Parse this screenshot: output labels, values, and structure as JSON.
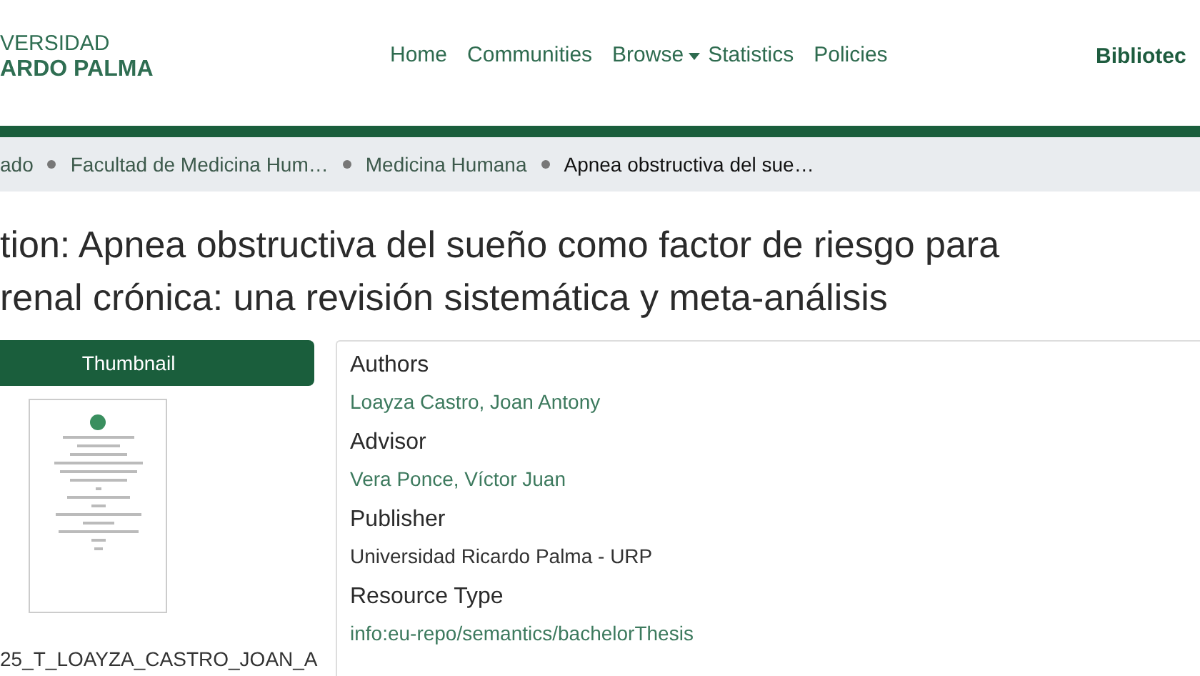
{
  "header": {
    "logo_lines": [
      "VERSIDAD",
      "ARDO PALMA"
    ],
    "nav": [
      {
        "label": "Home",
        "dropdown": false
      },
      {
        "label": "Communities",
        "dropdown": false
      },
      {
        "label": "Browse",
        "dropdown": true
      },
      {
        "label": "Statistics",
        "dropdown": false
      },
      {
        "label": "Policies",
        "dropdown": false
      }
    ],
    "site_title": "Bibliotec"
  },
  "breadcrumb": [
    {
      "label": "ado",
      "current": false
    },
    {
      "label": "Facultad de Medicina Hum…",
      "current": false
    },
    {
      "label": "Medicina Humana",
      "current": false
    },
    {
      "label": "Apnea obstructiva del sue…",
      "current": true
    }
  ],
  "title_lines": [
    "tion: Apnea obstructiva del sueño como factor de riesgo para",
    "renal crónica: una revisión sistemática y meta-análisis"
  ],
  "thumbnail": {
    "heading": "Thumbnail",
    "file_name": "25_T_LOAYZA_CASTRO_JOAN_A"
  },
  "fields": [
    {
      "label": "Authors",
      "value": "Loayza Castro, Joan Antony",
      "link": true
    },
    {
      "label": "Advisor",
      "value": "Vera Ponce, Víctor Juan",
      "link": true
    },
    {
      "label": "Publisher",
      "value": "Universidad Ricardo Palma - URP",
      "link": false
    },
    {
      "label": "Resource Type",
      "value": "info:eu-repo/semantics/bachelorThesis",
      "link": true
    }
  ]
}
